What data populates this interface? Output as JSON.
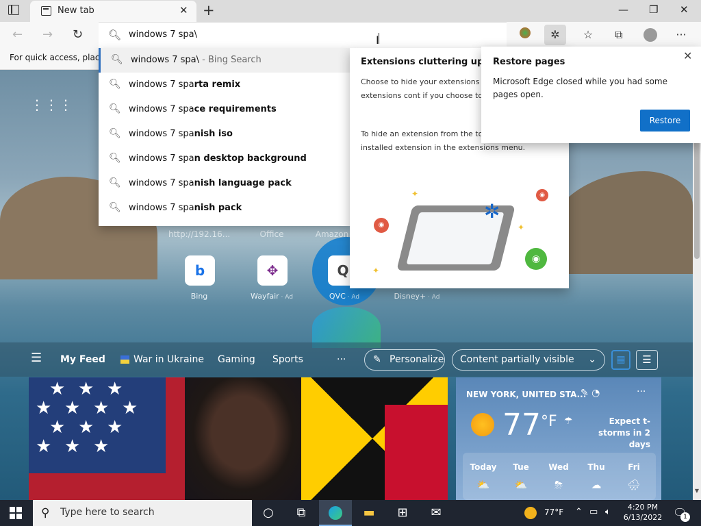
{
  "browser": {
    "tab_title": "New tab",
    "address_value": "windows 7 spa\\",
    "favorites_hint": "For quick access, place y"
  },
  "suggestions": [
    {
      "typed": "windows 7 spa\\",
      "rest": "",
      "source": " - Bing Search"
    },
    {
      "typed": "windows 7 spa",
      "rest": "rta remix",
      "source": ""
    },
    {
      "typed": "windows 7 spa",
      "rest": "ce requirements",
      "source": ""
    },
    {
      "typed": "windows 7 spa",
      "rest": "nish iso",
      "source": ""
    },
    {
      "typed": "windows 7 spa",
      "rest": "n desktop background",
      "source": ""
    },
    {
      "typed": "windows 7 spa",
      "rest": "nish language pack",
      "source": ""
    },
    {
      "typed": "windows 7 spa",
      "rest": "nish pack",
      "source": ""
    }
  ],
  "extensions_popup": {
    "title": "Extensions cluttering up yo",
    "p1": "Choose to hide your extensions a your toolbar. The extensions cont if you choose to hide them.",
    "p2": "To hide an extension from the too icon for any installed extension in the extensions menu."
  },
  "restore_popup": {
    "title": "Restore pages",
    "message": "Microsoft Edge closed while you had some pages open.",
    "button": "Restore"
  },
  "quick_links": {
    "top_labels": [
      "http://192.16...",
      "Office",
      "Amazon"
    ],
    "tiles": [
      {
        "name": "Bing",
        "ad": ""
      },
      {
        "name": "Wayfair",
        "ad": " · Ad"
      },
      {
        "name": "QVC",
        "ad": " · Ad"
      },
      {
        "name": "Disney+",
        "ad": " · Ad"
      }
    ]
  },
  "feed": {
    "my_feed": "My Feed",
    "tabs": [
      "War in Ukraine",
      "Gaming",
      "Sports"
    ],
    "more": "···",
    "personalize": "Personalize",
    "content_visibility": "Content partially visible"
  },
  "weather": {
    "location": "NEW YORK, UNITED STA...",
    "temp": "77",
    "unit": "°F",
    "alert": "Expect t-storms in 2 days",
    "days": [
      "Today",
      "Tue",
      "Wed",
      "Thu",
      "Fri"
    ]
  },
  "taskbar": {
    "search_placeholder": "Type here to search",
    "weather_temp": "77°F",
    "time": "4:20 PM",
    "date": "6/13/2022",
    "notification_count": "1"
  },
  "colors": {
    "accent": "#1170c8",
    "taskbar": "#1f2530",
    "suggestion_marker": "#2f6fbd"
  }
}
